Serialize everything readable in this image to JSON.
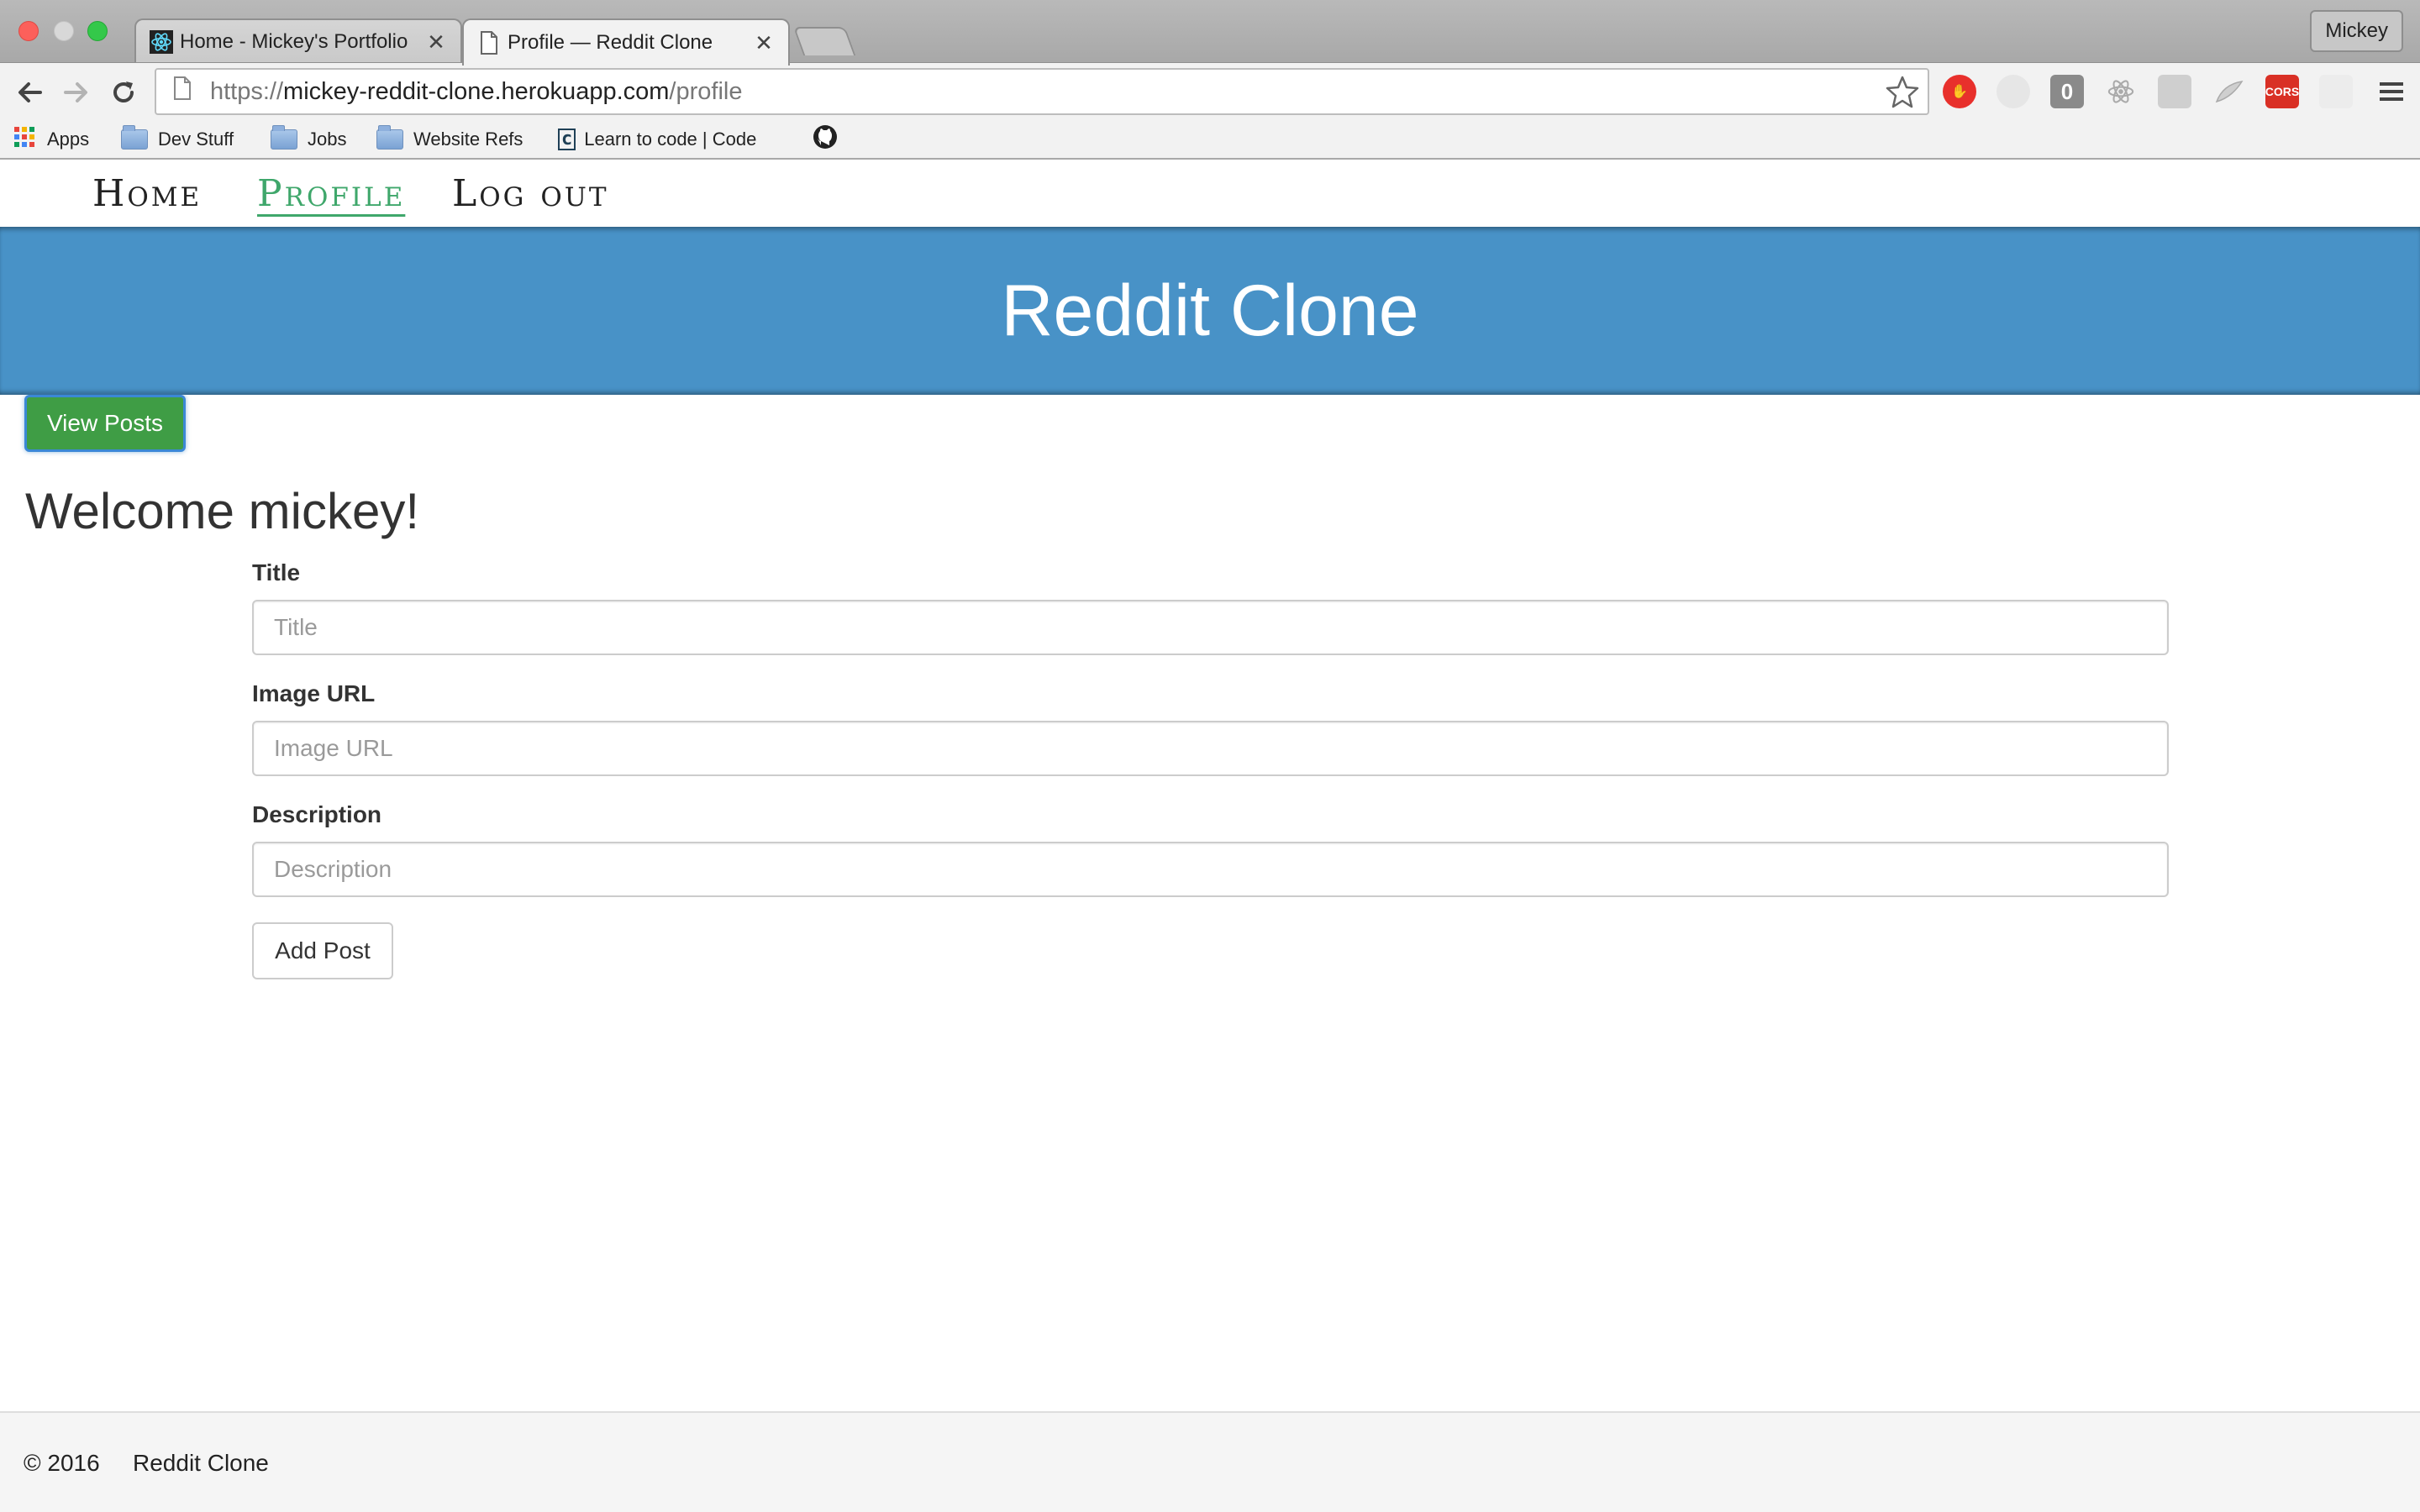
{
  "browser": {
    "tabs": [
      {
        "title": "Home - Mickey's Portfolio",
        "close": "✕",
        "active": false,
        "icon": "react-icon"
      },
      {
        "title": "Profile — Reddit Clone",
        "close": "✕",
        "active": true,
        "icon": "page-icon"
      }
    ],
    "profile_name": "Mickey",
    "url": {
      "scheme": "https://",
      "host": "mickey-reddit-clone.herokuapp.com",
      "path": "/profile"
    },
    "bookmarks": [
      {
        "label": "Apps",
        "icon": "apps-grid-icon"
      },
      {
        "label": "Dev Stuff",
        "icon": "folder-icon"
      },
      {
        "label": "Jobs",
        "icon": "folder-icon"
      },
      {
        "label": "Website Refs",
        "icon": "folder-icon"
      },
      {
        "label": "Learn to code | Code",
        "icon": "codecademy-icon"
      },
      {
        "label": "",
        "icon": "github-icon"
      }
    ],
    "extensions": [
      {
        "name": "adblock-icon",
        "color": "#e8302c"
      },
      {
        "name": "extension-icon",
        "color": "#cfcfcf"
      },
      {
        "name": "counter-extension-icon",
        "text": "0",
        "color": "#8a8a8a"
      },
      {
        "name": "react-devtools-icon",
        "color": "#bdbdbd"
      },
      {
        "name": "extension-icon",
        "color": "#bdbdbd"
      },
      {
        "name": "feather-extension-icon",
        "color": "#bdbdbd"
      },
      {
        "name": "cors-extension-icon",
        "text": "CORS",
        "color": "#d93025"
      },
      {
        "name": "extension-icon",
        "color": "#cfcfcf"
      }
    ]
  },
  "site": {
    "nav": [
      {
        "label": "Home",
        "active": false
      },
      {
        "label": "Profile",
        "active": true
      },
      {
        "label": "Log out",
        "active": false
      }
    ],
    "banner_title": "Reddit Clone",
    "view_posts_label": "View Posts",
    "welcome": "Welcome mickey!",
    "form": {
      "title": {
        "label": "Title",
        "placeholder": "Title",
        "value": ""
      },
      "image_url": {
        "label": "Image URL",
        "placeholder": "Image URL",
        "value": ""
      },
      "description": {
        "label": "Description",
        "placeholder": "Description",
        "value": ""
      },
      "submit_label": "Add Post"
    },
    "footer": {
      "copyright": "© 2016",
      "brand": "Reddit Clone"
    }
  },
  "colors": {
    "banner": "#4892c7",
    "nav_active": "#3fa76b",
    "view_posts_button": "#3f9d45"
  }
}
